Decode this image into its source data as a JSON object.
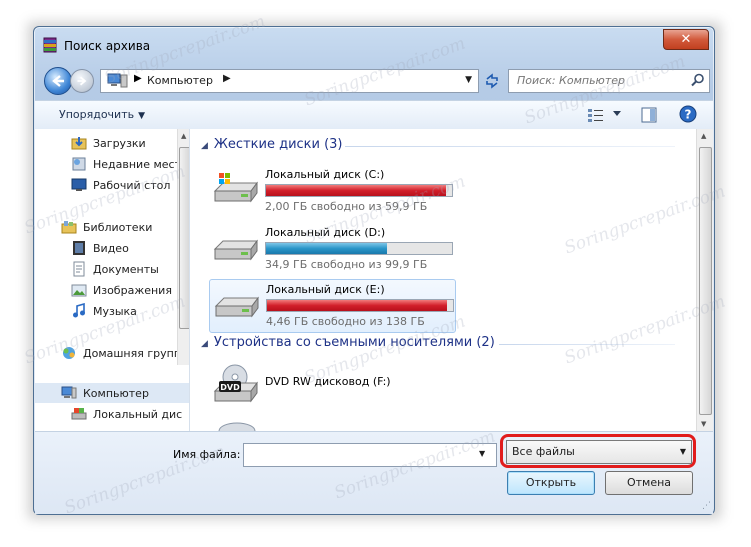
{
  "window": {
    "title": "Поиск архива",
    "close_glyph": "✕"
  },
  "address_bar": {
    "crumb": "Компьютер",
    "separator": "▶",
    "dropdown": "▼"
  },
  "search": {
    "placeholder": "Поиск: Компьютер"
  },
  "toolbar": {
    "organize_label": "Упорядочить",
    "organize_arrow": "▼"
  },
  "nav": {
    "items": [
      {
        "label": "Загрузки",
        "icon": "downloads-icon"
      },
      {
        "label": "Недавние мест",
        "icon": "recent-places-icon"
      },
      {
        "label": "Рабочий стол",
        "icon": "desktop-icon"
      },
      {
        "label": "Библиотеки",
        "icon": "libraries-icon"
      },
      {
        "label": "Видео",
        "icon": "video-library-icon"
      },
      {
        "label": "Документы",
        "icon": "documents-library-icon"
      },
      {
        "label": "Изображения",
        "icon": "pictures-library-icon"
      },
      {
        "label": "Музыка",
        "icon": "music-library-icon"
      },
      {
        "label": "Домашняя групп",
        "icon": "homegroup-icon"
      },
      {
        "label": "Компьютер",
        "icon": "computer-icon"
      },
      {
        "label": "Локальный дис",
        "icon": "local-disk-icon"
      }
    ]
  },
  "groups": {
    "hard_disks": "Жесткие диски (3)",
    "removable": "Устройства со съемными носителями (2)"
  },
  "drives": [
    {
      "name": "Локальный диск (C:)",
      "free_text": "2,00 ГБ свободно из 59,9 ГБ",
      "used_fraction": 0.967,
      "color": "red"
    },
    {
      "name": "Локальный диск (D:)",
      "free_text": "34,9 ГБ свободно из 99,9 ГБ",
      "used_fraction": 0.651,
      "color": "blue"
    },
    {
      "name": "Локальный диск (E:)",
      "free_text": "4,46 ГБ свободно из 138 ГБ",
      "used_fraction": 0.968,
      "color": "red"
    }
  ],
  "removable_drives": [
    {
      "name": "DVD RW дисковод (F:)",
      "badge": "DVD"
    }
  ],
  "footer": {
    "filename_label": "Имя файла:",
    "filename_value": "",
    "filter_value": "Все файлы",
    "open_label": "Открыть",
    "cancel_label": "Отмена"
  },
  "watermark": "Soringpcrepair.com",
  "colors": {
    "highlight": "#e11c1c",
    "group_header": "#1e3287",
    "bar_red": "#d21f2a",
    "bar_blue": "#2a95c8"
  }
}
